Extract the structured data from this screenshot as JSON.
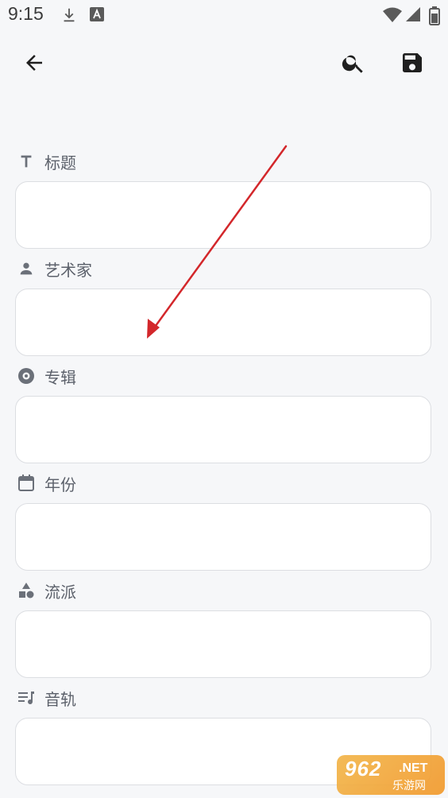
{
  "status_bar": {
    "time": "9:15",
    "icons": [
      "download-icon",
      "a-badge-icon",
      "wifi-icon",
      "signal-icon",
      "battery-icon"
    ]
  },
  "toolbar": {
    "back_icon": "arrow-back-icon",
    "search_icon": "search-icon",
    "save_icon": "save-icon"
  },
  "fields": [
    {
      "label": "标题",
      "icon": "title-t-icon",
      "value": ""
    },
    {
      "label": "艺术家",
      "icon": "person-icon",
      "value": ""
    },
    {
      "label": "专辑",
      "icon": "disc-icon",
      "value": ""
    },
    {
      "label": "年份",
      "icon": "calendar-icon",
      "value": ""
    },
    {
      "label": "流派",
      "icon": "shapes-icon",
      "value": ""
    },
    {
      "label": "音轨",
      "icon": "track-list-icon",
      "value": ""
    }
  ],
  "colors": {
    "background": "#f6f7f9",
    "label": "#5c616b",
    "icon": "#6b7079",
    "field_border": "#dcdee2",
    "annotation_arrow": "#d3272b"
  },
  "watermark": {
    "big": "962",
    "net": ".NET",
    "small": "乐游网"
  }
}
